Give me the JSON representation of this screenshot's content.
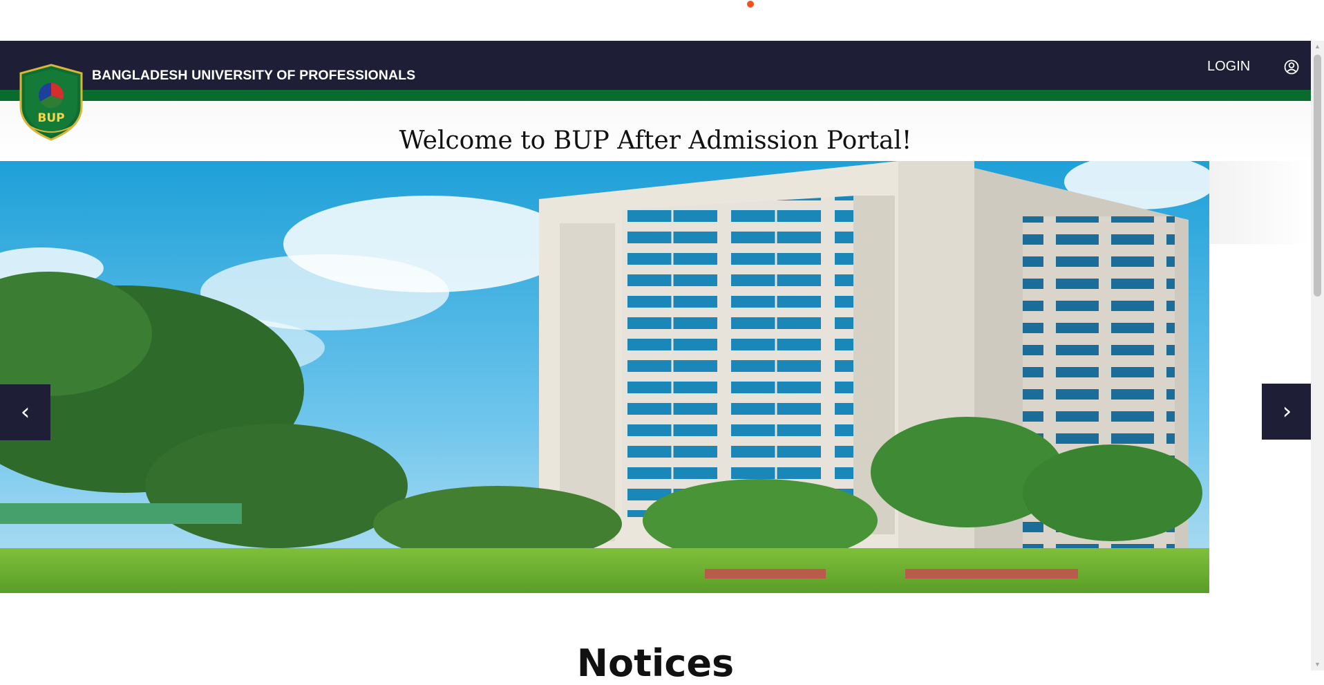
{
  "header": {
    "university_name": "BANGLADESH UNIVERSITY OF PROFESSIONALS",
    "login_label": "LOGIN",
    "logo_text": "BUP"
  },
  "hero": {
    "welcome_text": "Welcome to BUP After Admission Portal!",
    "prev_arrow": "‹",
    "next_arrow": "›"
  },
  "notices": {
    "heading": "Notices"
  },
  "icons": {
    "user": "user-circle-icon",
    "loader": "loading-dot-icon",
    "prev": "chevron-left-icon",
    "next": "chevron-right-icon"
  },
  "colors": {
    "header_bg": "#1e1e36",
    "accent_green": "#0a6b2e",
    "loader_orange": "#f4511e"
  }
}
